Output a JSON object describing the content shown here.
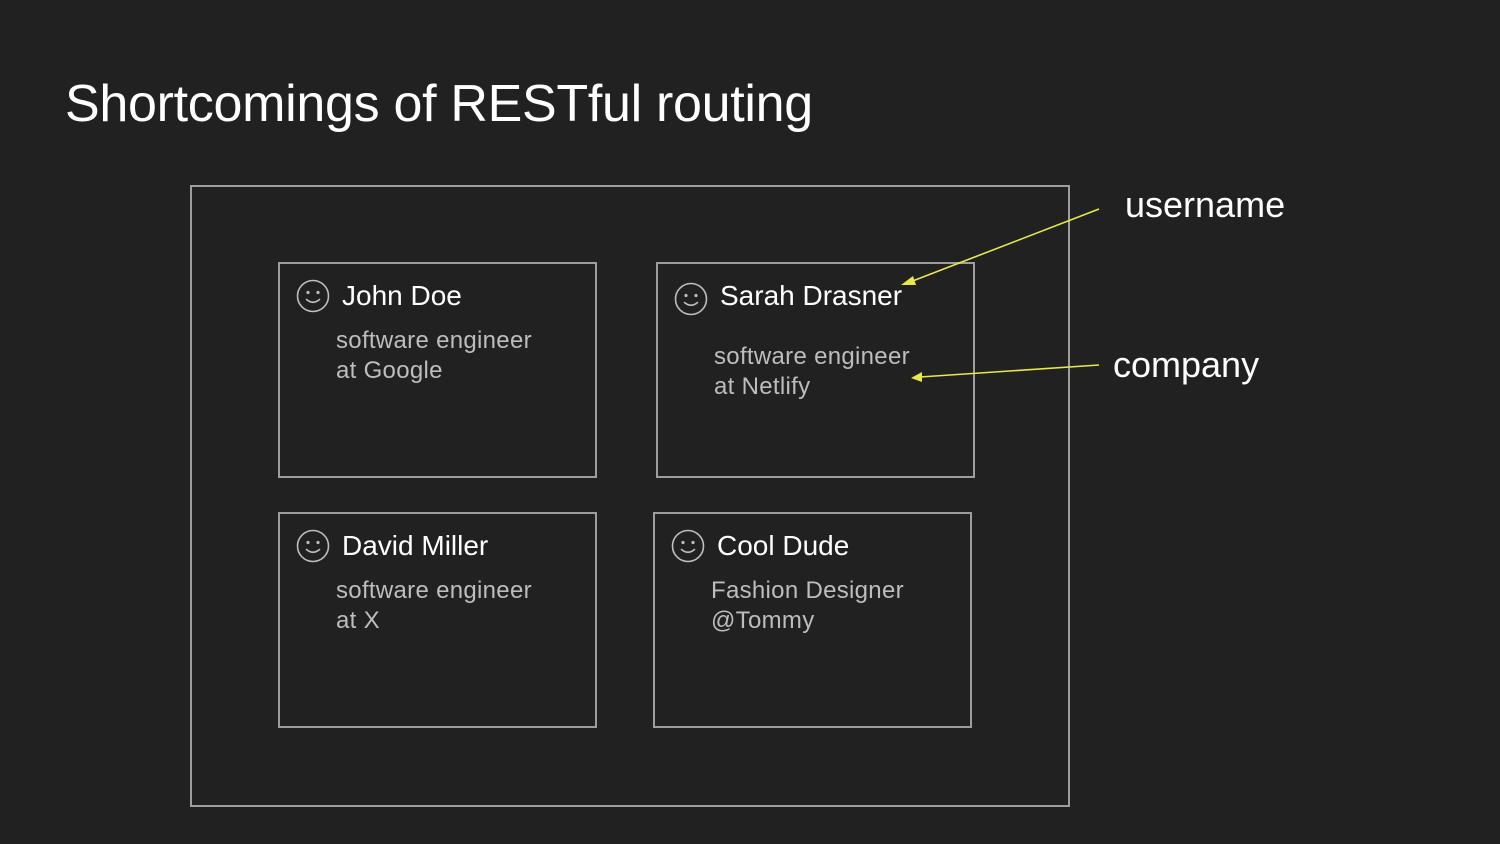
{
  "slide": {
    "title": "Shortcomings of RESTful routing"
  },
  "cards": [
    {
      "name": "John Doe",
      "desc_line1": "software engineer",
      "desc_line2": "at Google",
      "icon": "smiley-face-icon"
    },
    {
      "name": "Sarah Drasner",
      "desc_line1": "software engineer",
      "desc_line2": "at Netlify",
      "icon": "smiley-face-icon"
    },
    {
      "name": "David Miller",
      "desc_line1": "software engineer",
      "desc_line2": "at X",
      "icon": "smiley-face-icon"
    },
    {
      "name": "Cool Dude",
      "desc_line1": "Fashion Designer",
      "desc_line2": "@Tommy",
      "icon": "smiley-face-icon"
    }
  ],
  "annotations": {
    "username": "username",
    "company": "company"
  },
  "colors": {
    "background": "#212121",
    "border": "#9e9e9e",
    "arrow": "#e8e84a",
    "title_text": "#ffffff",
    "desc_text": "#bdbdbd"
  }
}
